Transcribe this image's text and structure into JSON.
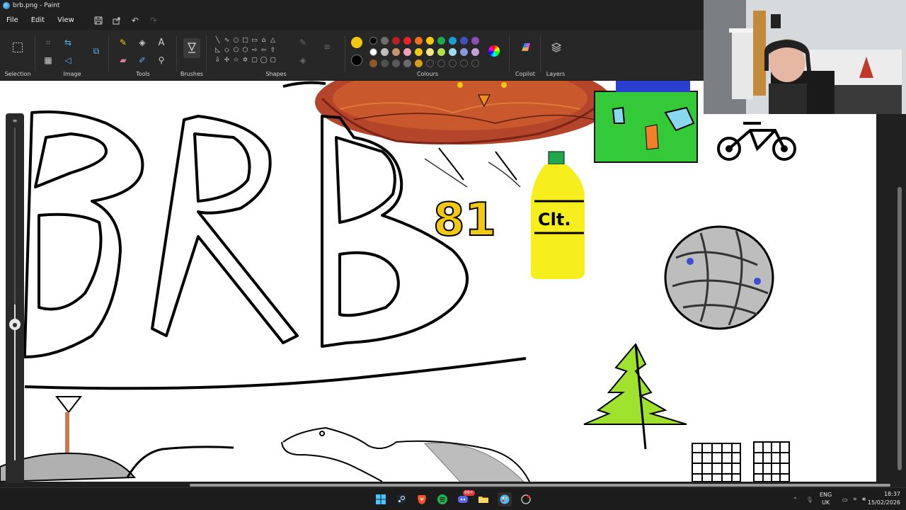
{
  "window": {
    "title": "brb.png - Paint"
  },
  "menu": {
    "file": "File",
    "edit": "Edit",
    "view": "View"
  },
  "ribbon": {
    "groups": {
      "selection": "Selection",
      "image": "Image",
      "tools": "Tools",
      "brushes": "Brushes",
      "shapes": "Shapes",
      "colours": "Colours",
      "copilot": "Copilot",
      "layers": "Layers"
    },
    "text_tool_glyph": "A",
    "shape_glyphs": [
      "\\",
      "∿",
      "○",
      "□",
      "▭",
      "⌂",
      "△",
      "",
      "◇",
      "⬠",
      "⬡",
      "⇨",
      "⇦",
      "⇧",
      "",
      "",
      "⇩",
      "✢",
      "☆",
      "✡",
      "▢",
      "○",
      "▢",
      "",
      "",
      "",
      "",
      "",
      "",
      "",
      "",
      ""
    ],
    "active_color": "#f2c811",
    "secondary_color": "#000000",
    "palette_row1": [
      "#000000",
      "#6e6e6e",
      "#b22222",
      "#e8212a",
      "#f37021",
      "#f6c915",
      "#1aab4b",
      "#16a0d7",
      "#3e4fc5",
      "#8a4fb3"
    ],
    "palette_row2": [
      "#ffffff",
      "#bfbfbf",
      "#c8926a",
      "#f6a1b9",
      "#f6c915",
      "#f3e78c",
      "#b5e051",
      "#9fd9ef",
      "#8a9ad8",
      "#c5a1d9"
    ],
    "palette_row3": [
      "#8a5a2b",
      "#505050",
      "#5a5a5a",
      "#6a6a6a",
      "#d4a017",
      "",
      "",
      "",
      "",
      ""
    ]
  },
  "drawing": {
    "big_letters": "BRB",
    "number_text": "81",
    "bottle_label": "Clt.",
    "description_colors": {
      "bottle": "#f7ee1e",
      "house": "#34c938",
      "tree": "#9ee22d",
      "nest": "#c0502a"
    }
  },
  "taskbar": {
    "language": "ENG",
    "region": "UK",
    "time": "18:37",
    "date": "15/02/2026",
    "notification_badge": "99+"
  }
}
